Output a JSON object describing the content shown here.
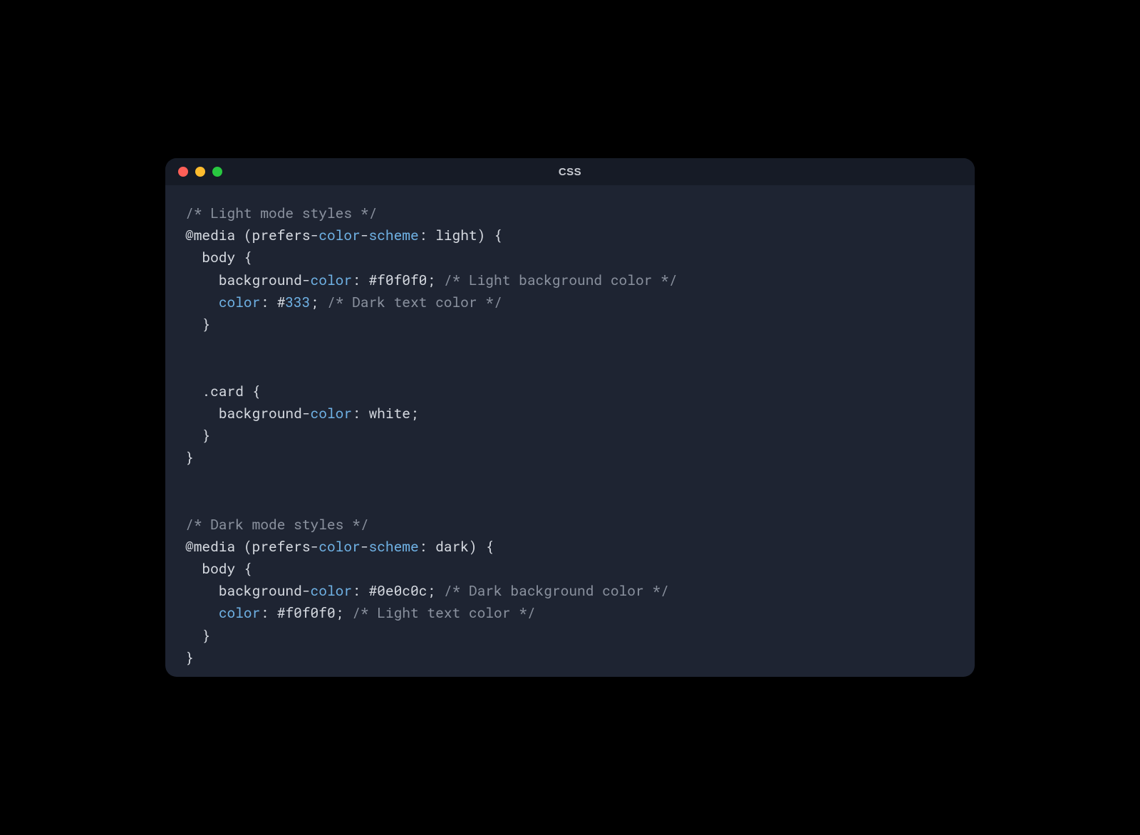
{
  "window": {
    "title": "CSS"
  },
  "traffic": {
    "close": "close",
    "minimize": "minimize",
    "maximize": "maximize"
  },
  "code": {
    "l1": {
      "comment": "/* Light mode styles */"
    },
    "l2": {
      "at": "@",
      "media": "media",
      "lp": "(",
      "prefers": "prefers-",
      "colorword": "color",
      "dash": "-",
      "scheme": "scheme",
      "colon": ":",
      "sp": " ",
      "val": "light",
      "rp": ")",
      "sp2": " ",
      "ob": "{"
    },
    "l3": {
      "indent": "  ",
      "sel": "body",
      "sp": " ",
      "ob": "{"
    },
    "l4": {
      "indent": "    ",
      "prop1": "background-",
      "colorword": "color",
      "colon": ":",
      "sp": " ",
      "hash": "#",
      "hex": "f0f0f0",
      "semi": ";",
      "sp2": " ",
      "comment": "/* Light background color */"
    },
    "l5": {
      "indent": "    ",
      "colorword": "color",
      "colon": ":",
      "sp": " ",
      "hash": "#",
      "hex": "333",
      "semi": ";",
      "sp2": " ",
      "comment": "/* Dark text color */"
    },
    "l6": {
      "indent": "  ",
      "cb": "}"
    },
    "l7": {
      "blank": ""
    },
    "l8": {
      "blank": ""
    },
    "l9": {
      "indent": "  ",
      "sel": ".card",
      "sp": " ",
      "ob": "{"
    },
    "l10": {
      "indent": "    ",
      "prop1": "background-",
      "colorword": "color",
      "colon": ":",
      "sp": " ",
      "val": "white",
      "semi": ";"
    },
    "l11": {
      "indent": "  ",
      "cb": "}"
    },
    "l12": {
      "cb": "}"
    },
    "l13": {
      "blank": ""
    },
    "l14": {
      "blank": ""
    },
    "l15": {
      "comment": "/* Dark mode styles */"
    },
    "l16": {
      "at": "@",
      "media": "media",
      "lp": "(",
      "prefers": "prefers-",
      "colorword": "color",
      "dash": "-",
      "scheme": "scheme",
      "colon": ":",
      "sp": " ",
      "val": "dark",
      "rp": ")",
      "sp2": " ",
      "ob": "{"
    },
    "l17": {
      "indent": "  ",
      "sel": "body",
      "sp": " ",
      "ob": "{"
    },
    "l18": {
      "indent": "    ",
      "prop1": "background-",
      "colorword": "color",
      "colon": ":",
      "sp": " ",
      "hash": "#",
      "hex": "0e0c0c",
      "semi": ";",
      "sp2": " ",
      "comment": "/* Dark background color */"
    },
    "l19": {
      "indent": "    ",
      "colorword": "color",
      "colon": ":",
      "sp": " ",
      "hash": "#",
      "hex": "f0f0f0",
      "semi": ";",
      "sp2": " ",
      "comment": "/* Light text color */"
    },
    "l20": {
      "indent": "  ",
      "cb": "}"
    },
    "l21": {
      "cb": "}"
    }
  }
}
